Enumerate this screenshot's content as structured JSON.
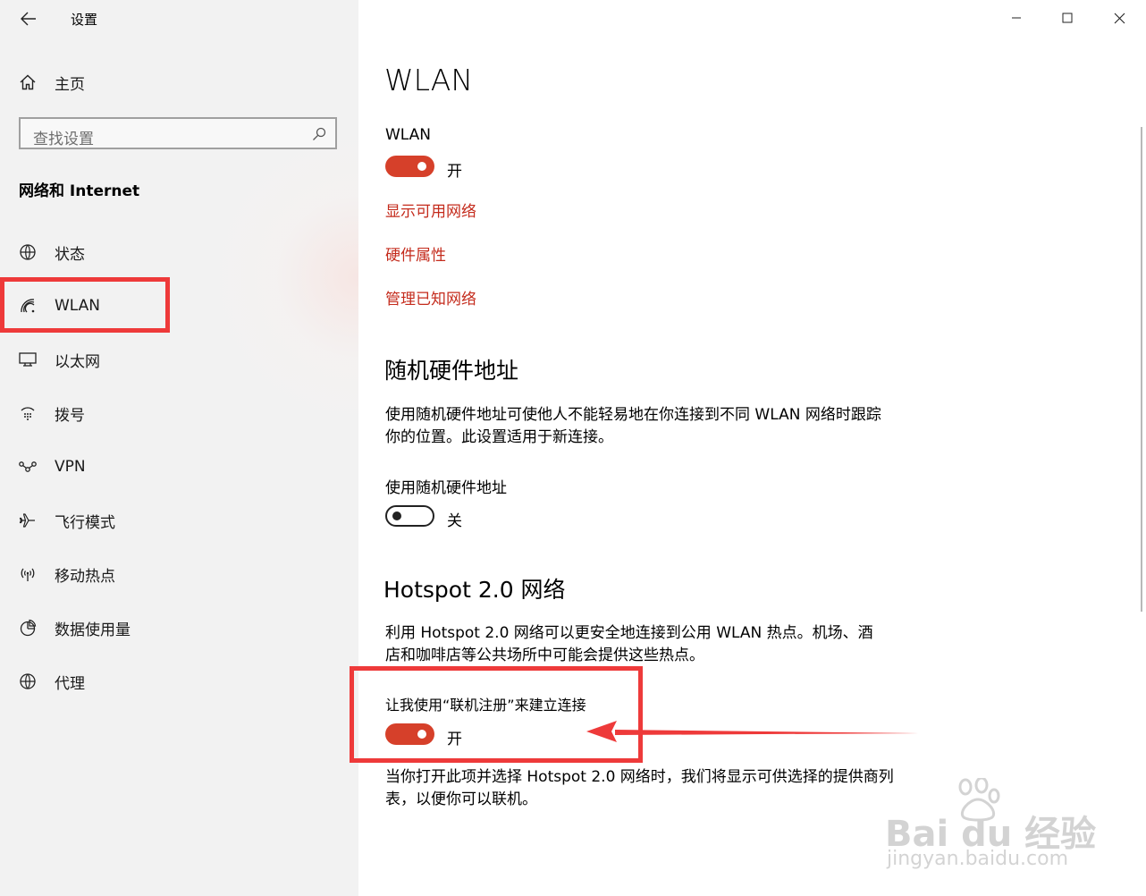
{
  "window": {
    "title": "设置"
  },
  "sidebar": {
    "home": "主页",
    "search_placeholder": "查找设置",
    "section_title": "网络和 Internet",
    "items": [
      {
        "label": "状态",
        "icon": "globe-status-icon"
      },
      {
        "label": "WLAN",
        "icon": "wifi-icon"
      },
      {
        "label": "以太网",
        "icon": "ethernet-icon"
      },
      {
        "label": "拨号",
        "icon": "dialup-icon"
      },
      {
        "label": "VPN",
        "icon": "vpn-icon"
      },
      {
        "label": "飞行模式",
        "icon": "airplane-icon"
      },
      {
        "label": "移动热点",
        "icon": "hotspot-icon"
      },
      {
        "label": "数据使用量",
        "icon": "data-usage-icon"
      },
      {
        "label": "代理",
        "icon": "globe-proxy-icon"
      }
    ]
  },
  "main": {
    "page_title": "WLAN",
    "wlan_toggle": {
      "label": "WLAN",
      "state": "开",
      "on": true
    },
    "links": [
      "显示可用网络",
      "硬件属性",
      "管理已知网络"
    ],
    "random_mac": {
      "heading": "随机硬件地址",
      "description": "使用随机硬件地址可使他人不能轻易地在你连接到不同 WLAN 网络时跟踪你的位置。此设置适用于新连接。",
      "toggle_label": "使用随机硬件地址",
      "state": "关",
      "on": false
    },
    "hotspot": {
      "heading": "Hotspot 2.0 网络",
      "description": "利用 Hotspot 2.0 网络可以更安全地连接到公用 WLAN 热点。机场、酒店和咖啡店等公共场所中可能会提供这些热点。",
      "toggle_label": "让我使用“联机注册”来建立连接",
      "state": "开",
      "on": true,
      "footer": "当你打开此项并选择 Hotspot 2.0 网络时，我们将显示可供选择的提供商列表，以便你可以联机。"
    }
  },
  "watermark": {
    "brand": "Bai du 经验",
    "url": "jingyan.baidu.com"
  },
  "colors": {
    "accent": "#c42b1c",
    "toggle_on": "#d6402a",
    "annotation": "#ee3a3a",
    "sidebar_bg": "#f2f2f2"
  }
}
